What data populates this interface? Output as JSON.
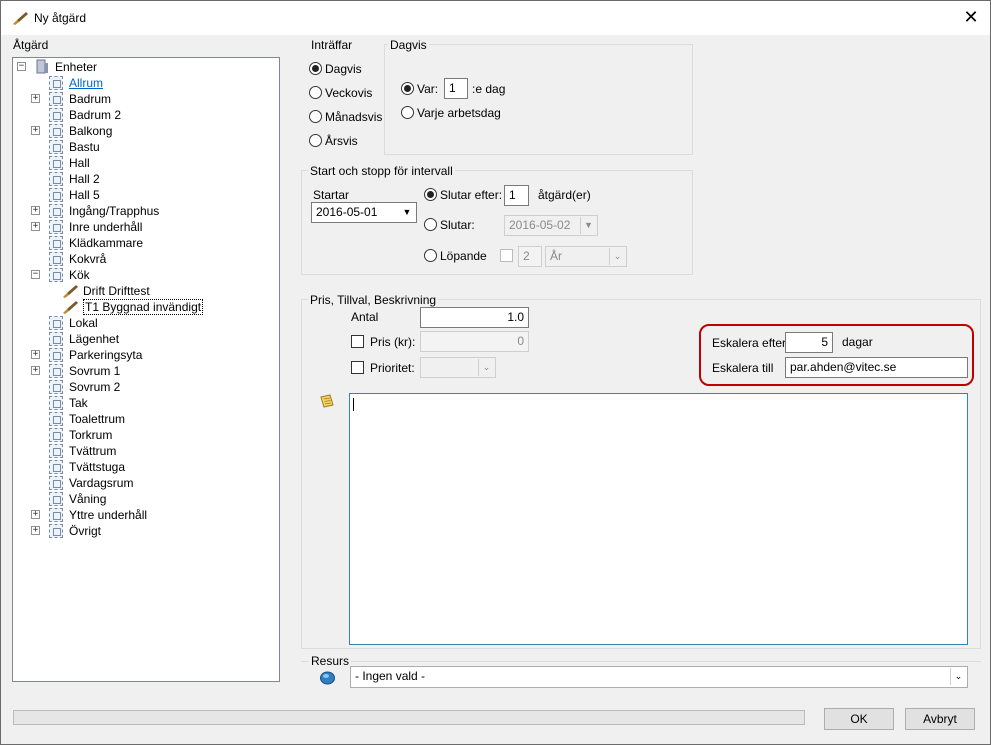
{
  "window": {
    "title": "Ny åtgärd"
  },
  "tree": {
    "label": "Åtgärd",
    "root": "Enheter",
    "items": [
      {
        "label": "Allrum",
        "expandable": false,
        "selected": true
      },
      {
        "label": "Badrum",
        "expandable": true
      },
      {
        "label": "Badrum 2",
        "expandable": false
      },
      {
        "label": "Balkong",
        "expandable": true
      },
      {
        "label": "Bastu",
        "expandable": false
      },
      {
        "label": "Hall",
        "expandable": false
      },
      {
        "label": "Hall 2",
        "expandable": false
      },
      {
        "label": "Hall 5",
        "expandable": false
      },
      {
        "label": "Ingång/Trapphus",
        "expandable": true
      },
      {
        "label": "Inre underhåll",
        "expandable": true
      },
      {
        "label": "Klädkammare",
        "expandable": false
      },
      {
        "label": "Kokvrå",
        "expandable": false
      },
      {
        "label": "Kök",
        "expandable": true,
        "expanded": true
      },
      {
        "label": "Lokal",
        "expandable": false
      },
      {
        "label": "Lägenhet",
        "expandable": false
      },
      {
        "label": "Parkeringsyta",
        "expandable": true
      },
      {
        "label": "Sovrum 1",
        "expandable": true
      },
      {
        "label": "Sovrum 2",
        "expandable": false
      },
      {
        "label": "Tak",
        "expandable": false
      },
      {
        "label": "Toalettrum",
        "expandable": false
      },
      {
        "label": "Torkrum",
        "expandable": false
      },
      {
        "label": "Tvättrum",
        "expandable": false
      },
      {
        "label": "Tvättstuga",
        "expandable": false
      },
      {
        "label": "Vardagsrum",
        "expandable": false
      },
      {
        "label": "Våning",
        "expandable": false
      },
      {
        "label": "Yttre underhåll",
        "expandable": true
      },
      {
        "label": "Övrigt",
        "expandable": true
      }
    ],
    "kok_children": [
      "Drift Drifttest",
      "T1 Byggnad invändigt"
    ]
  },
  "occurs": {
    "title": "Inträffar",
    "options": [
      "Dagvis",
      "Veckovis",
      "Månadsvis",
      "Årsvis"
    ],
    "selected": "Dagvis"
  },
  "daily": {
    "title": "Dagvis",
    "every_label": "Var:",
    "every_value": "1",
    "every_suffix": ":e dag",
    "workday_label": "Varje arbetsdag"
  },
  "interval": {
    "title": "Start och stopp för intervall",
    "start_label": "Startar",
    "start_value": "2016-05-01",
    "ends_after_label": "Slutar efter:",
    "ends_after_value": "1",
    "ends_after_suffix": "åtgärd(er)",
    "ends_label": "Slutar:",
    "ends_value": "2016-05-02",
    "running_label": "Löpande",
    "running_value": "2",
    "running_unit": "År"
  },
  "price": {
    "title": "Pris, Tillval, Beskrivning",
    "qty_label": "Antal",
    "qty_value": "1.0",
    "price_label": "Pris (kr):",
    "price_value": "0",
    "priority_label": "Prioritet:",
    "escalate_after_label": "Eskalera efter",
    "escalate_after_value": "5",
    "escalate_after_unit": "dagar",
    "escalate_to_label": "Eskalera till",
    "escalate_to_value": "par.ahden@vitec.se",
    "description": "",
    "note_icon": "note-icon"
  },
  "resource": {
    "title": "Resurs",
    "value": "- Ingen vald -"
  },
  "buttons": {
    "ok": "OK",
    "cancel": "Avbryt"
  },
  "colors": {
    "highlight": "#c00000",
    "link": "#0066cc"
  }
}
